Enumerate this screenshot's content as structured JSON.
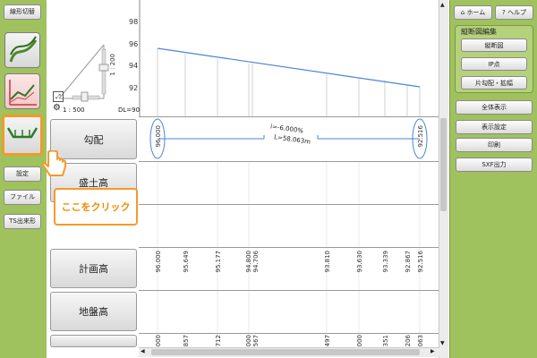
{
  "left_toolbar": {
    "shape_switch_label": "線形切替",
    "settings_label": "設定",
    "file_label": "ファイル",
    "ts_export_label": "TS出来形"
  },
  "profile_panel": {
    "y_ticks": [
      "98",
      "96",
      "94",
      "92"
    ],
    "scale_vertical": "1 : 200",
    "scale_horizontal": "1 : 500",
    "datum_level": "DL=90"
  },
  "rows": {
    "gradient_label": "勾配",
    "embankment_label": "盛土高",
    "plan_height_label": "計画高",
    "ground_height_label": "地盤高"
  },
  "gradient": {
    "start_value": "96.000",
    "end_value": "92.516",
    "slope_text": "i=-6.000%",
    "length_text": "L=58.063m"
  },
  "plan_heights": [
    "96.000",
    "95.649",
    "95.177",
    "94.800",
    "94.706",
    "93.810",
    "93.630",
    "93.339",
    "92.867",
    "92.516"
  ],
  "ground_heights_partial": [
    "000",
    "857",
    "712",
    "000",
    "567",
    "497",
    "000",
    "351",
    "206",
    "063"
  ],
  "callout_text": "ここをクリック",
  "right_panel": {
    "home_label": "ホーム",
    "help_label": "ヘルプ",
    "group_title": "縦断図編集",
    "longitudinal_label": "縦断図",
    "ip_point_label": "IP点",
    "cross_slope_label": "片勾配・拡幅",
    "show_all_label": "全体表示",
    "display_settings_label": "表示設定",
    "print_label": "印刷",
    "sxf_export_label": "SXF出力"
  },
  "colors": {
    "toolbar_green": "#9fc25e",
    "accent_orange": "#f39a2a",
    "profile_blue": "#4a86d4"
  }
}
